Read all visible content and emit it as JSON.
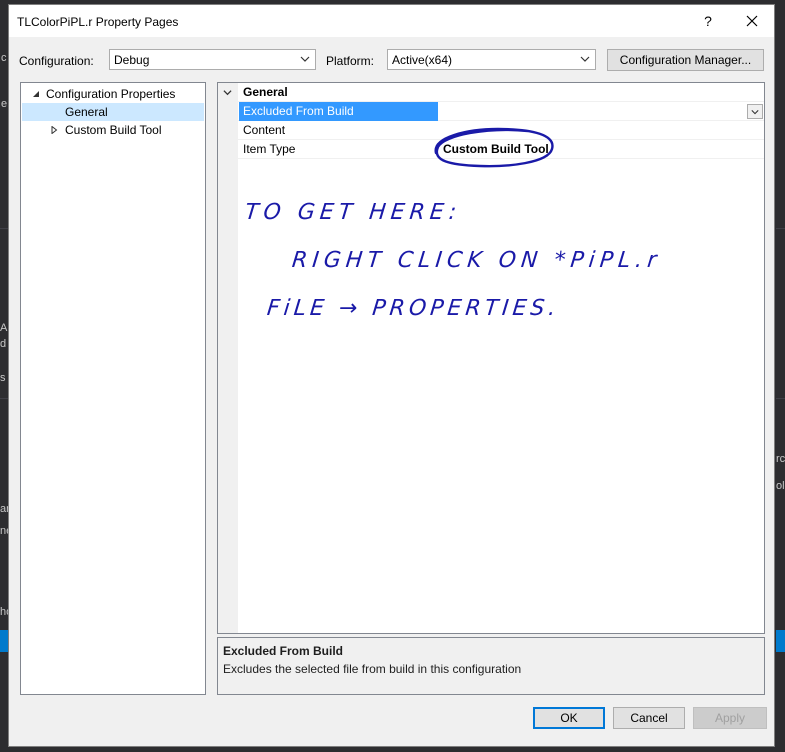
{
  "background": {
    "fragments": [
      "c",
      "e",
      "A",
      "d",
      "s",
      "rch",
      "olo",
      "ar",
      "ne",
      "ho"
    ]
  },
  "dialog": {
    "title": "TLColorPiPL.r Property Pages",
    "help_label": "?",
    "close_label": "✕"
  },
  "config_bar": {
    "configuration_label": "Configuration:",
    "configuration_value": "Debug",
    "platform_label": "Platform:",
    "platform_value": "Active(x64)",
    "manager_label": "Configuration Manager..."
  },
  "tree": {
    "items": [
      {
        "label": "Configuration Properties"
      },
      {
        "label": "General"
      },
      {
        "label": "Custom Build Tool"
      }
    ]
  },
  "grid": {
    "category": "General",
    "rows": [
      {
        "name": "Excluded From Build",
        "value": ""
      },
      {
        "name": "Content",
        "value": ""
      },
      {
        "name": "Item Type",
        "value": "Custom Build Tool"
      }
    ]
  },
  "annotation": {
    "line1": "TO GET HERE:",
    "line2": "RIGHT CLICK ON *PiPL.r",
    "line3": "FiLE → PROPERTIES.",
    "ink_color": "#1a1aa8"
  },
  "description": {
    "title": "Excluded From Build",
    "text": "Excludes the selected file from build in this configuration"
  },
  "buttons": {
    "ok": "OK",
    "cancel": "Cancel",
    "apply": "Apply"
  }
}
